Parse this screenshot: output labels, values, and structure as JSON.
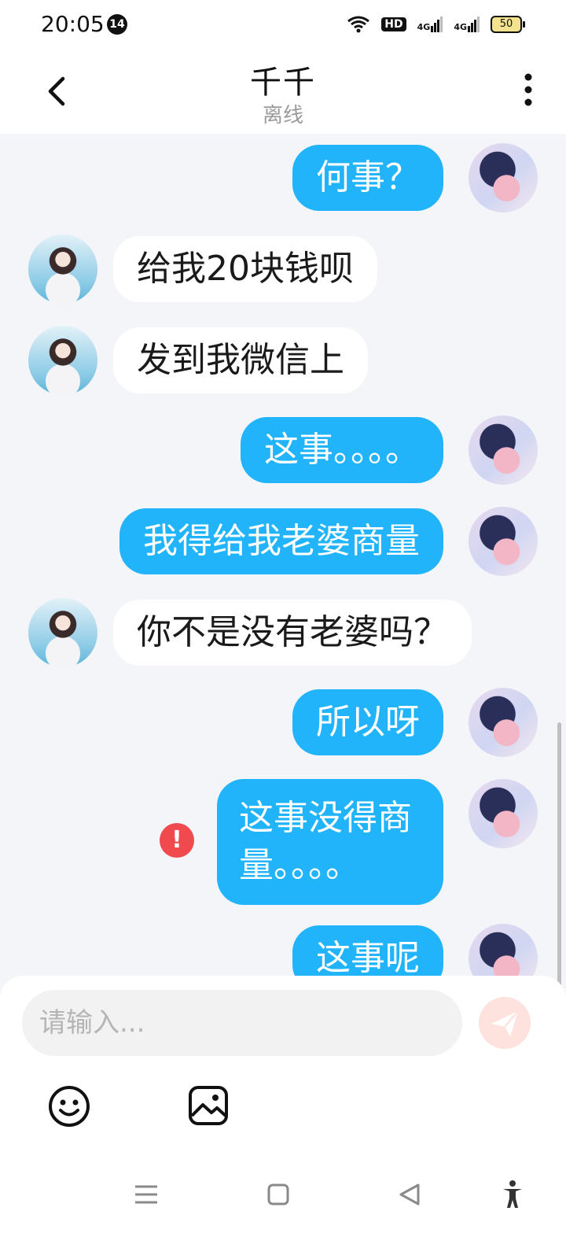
{
  "status_bar": {
    "time": "20:05",
    "notification_count": "14",
    "hd_label": "HD",
    "signal1_label": "4G",
    "signal2_label": "4G",
    "battery": "50"
  },
  "header": {
    "title": "千千",
    "status": "离线"
  },
  "messages": [
    {
      "from": "me",
      "text": "何事？"
    },
    {
      "from": "her",
      "text": "给我20块钱呗"
    },
    {
      "from": "her",
      "text": "发到我微信上"
    },
    {
      "from": "me",
      "text": "这事。。。。"
    },
    {
      "from": "me",
      "text": "我得给我老婆商量"
    },
    {
      "from": "her",
      "text": "你不是没有老婆吗？"
    },
    {
      "from": "me",
      "text": "所以呀"
    },
    {
      "from": "me",
      "text": "这事没得商量。。。。",
      "failed": true
    },
    {
      "from": "me",
      "text": "这事呢"
    }
  ],
  "error_mark": "!",
  "composer": {
    "placeholder": "请输入..."
  },
  "colors": {
    "my_bubble": "#22b4fb",
    "her_bubble": "#ffffff",
    "error": "#f04a4f",
    "send_disabled": "#fde2de"
  }
}
